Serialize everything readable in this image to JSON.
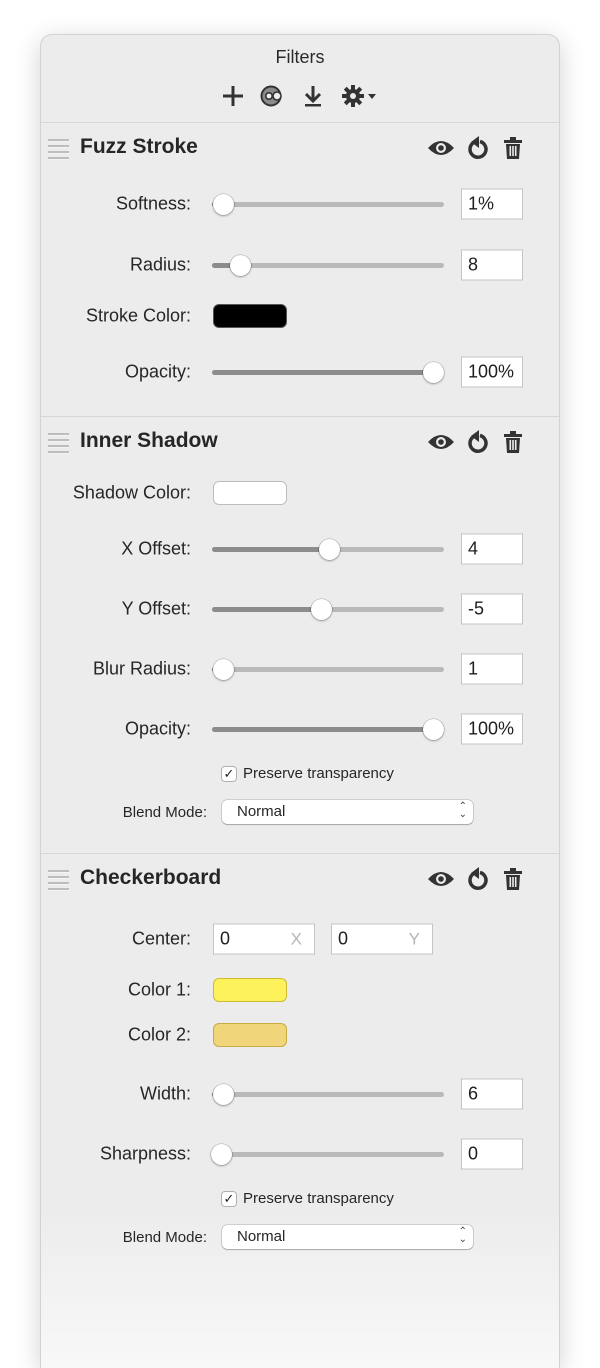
{
  "window": {
    "title": "Filters"
  },
  "toolbar": {
    "icons": [
      "add-icon",
      "effects-icon",
      "download-icon",
      "gear-icon"
    ]
  },
  "sections": [
    {
      "title": "Fuzz Stroke",
      "rows": {
        "softness": {
          "label": "Softness:",
          "value": "1%",
          "fraction": 0.01
        },
        "radius": {
          "label": "Radius:",
          "value": "8",
          "fraction": 0.09
        },
        "stroke_color": {
          "label": "Stroke Color:",
          "color": "#000000"
        },
        "opacity": {
          "label": "Opacity:",
          "value": "100%",
          "fraction": 1.0
        }
      }
    },
    {
      "title": "Inner Shadow",
      "rows": {
        "shadow_color": {
          "label": "Shadow Color:",
          "color": "#ffffff"
        },
        "x_offset": {
          "label": "X Offset:",
          "value": "4",
          "fraction": 0.51
        },
        "y_offset": {
          "label": "Y Offset:",
          "value": "-5",
          "fraction": 0.47
        },
        "blur_radius": {
          "label": "Blur Radius:",
          "value": "1",
          "fraction": 0.01
        },
        "opacity": {
          "label": "Opacity:",
          "value": "100%",
          "fraction": 1.0
        }
      },
      "preserve_transparency": {
        "label": "Preserve transparency",
        "checked": true,
        "mark": "✓"
      },
      "blend_mode": {
        "label": "Blend Mode:",
        "value": "Normal",
        "arrows": "⌃⌄"
      }
    },
    {
      "title": "Checkerboard",
      "rows": {
        "center": {
          "label": "Center:",
          "x": "0",
          "y": "0",
          "x_placeholder": "X",
          "y_placeholder": "Y"
        },
        "color1": {
          "label": "Color 1:",
          "color": "#fdf25c"
        },
        "color2": {
          "label": "Color 2:",
          "color": "#f1d57a"
        },
        "width": {
          "label": "Width:",
          "value": "6",
          "fraction": 0.01
        },
        "sharpness": {
          "label": "Sharpness:",
          "value": "0",
          "fraction": 0.0
        }
      },
      "preserve_transparency": {
        "label": "Preserve transparency",
        "checked": true,
        "mark": "✓"
      },
      "blend_mode": {
        "label": "Blend Mode:",
        "value": "Normal",
        "arrows": "⌃⌄"
      }
    }
  ]
}
